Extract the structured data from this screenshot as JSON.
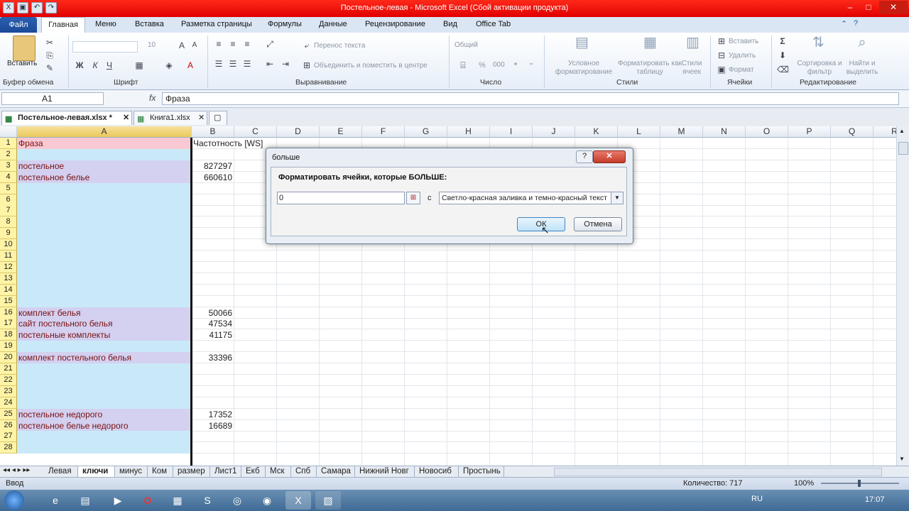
{
  "window": {
    "title": "Постельное-левая - Microsoft Excel (Сбой активации продукта)",
    "min": "–",
    "max": "□",
    "close": "✕"
  },
  "ribbon_tabs": [
    "Файл",
    "Главная",
    "Меню",
    "Вставка",
    "Разметка страницы",
    "Формулы",
    "Данные",
    "Рецензирование",
    "Вид",
    "Office Tab"
  ],
  "ribbon": {
    "paste": "Вставить",
    "clipboard_label": "Буфер обмена",
    "font_label": "Шрифт",
    "font_size": "10",
    "bold": "Ж",
    "italic": "К",
    "underline": "Ч",
    "align_label": "Выравнивание",
    "wrap_text": "Перенос текста",
    "merge_center": "Объединить и поместить в центре",
    "number_label": "Число",
    "number_format": "Общий",
    "percent": "%",
    "thousands": "000",
    "conditional": "Условное форматирование",
    "format_table": "Форматировать как таблицу",
    "cell_styles": "Стили ячеек",
    "styles_label": "Стили",
    "insert": "Вставить",
    "delete": "Удалить",
    "format": "Формат",
    "cells_label": "Ячейки",
    "sort_filter": "Сортировка и фильтр",
    "find_select": "Найти и выделить",
    "editing_label": "Редактирование"
  },
  "formula_bar": {
    "name_box": "A1",
    "fx": "fx",
    "formula": "Фраза"
  },
  "doc_tabs": [
    {
      "label": "Постельное-левая.xlsx *"
    },
    {
      "label": "Книга1.xlsx"
    }
  ],
  "columns": [
    "A",
    "B",
    "C",
    "D",
    "E",
    "F",
    "G",
    "H",
    "I",
    "J",
    "K",
    "L",
    "M",
    "N",
    "O",
    "P",
    "Q",
    "R"
  ],
  "rows": [
    {
      "n": "1",
      "a": "Фраза",
      "b": "Частотность [WS]"
    },
    {
      "n": "2",
      "a": "",
      "b": ""
    },
    {
      "n": "3",
      "a": "постельное",
      "b": "827297"
    },
    {
      "n": "4",
      "a": "постельное белье",
      "b": "660610"
    },
    {
      "n": "5",
      "a": "",
      "b": ""
    },
    {
      "n": "6",
      "a": "",
      "b": ""
    },
    {
      "n": "7",
      "a": "",
      "b": ""
    },
    {
      "n": "8",
      "a": "",
      "b": ""
    },
    {
      "n": "9",
      "a": "",
      "b": ""
    },
    {
      "n": "10",
      "a": "",
      "b": ""
    },
    {
      "n": "11",
      "a": "",
      "b": ""
    },
    {
      "n": "12",
      "a": "",
      "b": ""
    },
    {
      "n": "13",
      "a": "",
      "b": ""
    },
    {
      "n": "14",
      "a": "",
      "b": ""
    },
    {
      "n": "15",
      "a": "",
      "b": ""
    },
    {
      "n": "16",
      "a": "комплект белья",
      "b": "50066"
    },
    {
      "n": "17",
      "a": "сайт постельного белья",
      "b": "47534"
    },
    {
      "n": "18",
      "a": "постельные комплекты",
      "b": "41175"
    },
    {
      "n": "19",
      "a": "",
      "b": ""
    },
    {
      "n": "20",
      "a": "комплект постельного белья",
      "b": "33396"
    },
    {
      "n": "21",
      "a": "",
      "b": ""
    },
    {
      "n": "22",
      "a": "",
      "b": ""
    },
    {
      "n": "23",
      "a": "",
      "b": ""
    },
    {
      "n": "24",
      "a": "",
      "b": ""
    },
    {
      "n": "25",
      "a": "постельное недорого",
      "b": "17352"
    },
    {
      "n": "26",
      "a": "постельное белье недорого",
      "b": "16689"
    },
    {
      "n": "27",
      "a": "",
      "b": ""
    },
    {
      "n": "28",
      "a": "",
      "b": ""
    }
  ],
  "sheet_tabs": [
    "Левая",
    "ключи",
    "минус",
    "Ком",
    "размер",
    "Лист1",
    "Екб",
    "Мск",
    "Спб",
    "Самара",
    "Нижний Новг",
    "Новосиб",
    "Простынь"
  ],
  "active_sheet": "ключи",
  "status": {
    "mode": "Ввод",
    "count": "Количество: 717",
    "zoom": "100%",
    "lang": "RU",
    "time": "17:07"
  },
  "dialog": {
    "title": "больше",
    "caption": "Форматировать ячейки, которые БОЛЬШЕ:",
    "value": "0",
    "with_label": "с",
    "format_option": "Светло-красная заливка и темно-красный текст",
    "ok": "ОК",
    "cancel": "Отмена",
    "help": "?",
    "close": "✕"
  },
  "colors": {
    "title_bar": "#e00000",
    "row1_a": "#f9c9d3",
    "purple_fill": "#d3d0f0",
    "blue_fill": "#c9e9f8",
    "row_header": "#fff3a6"
  }
}
